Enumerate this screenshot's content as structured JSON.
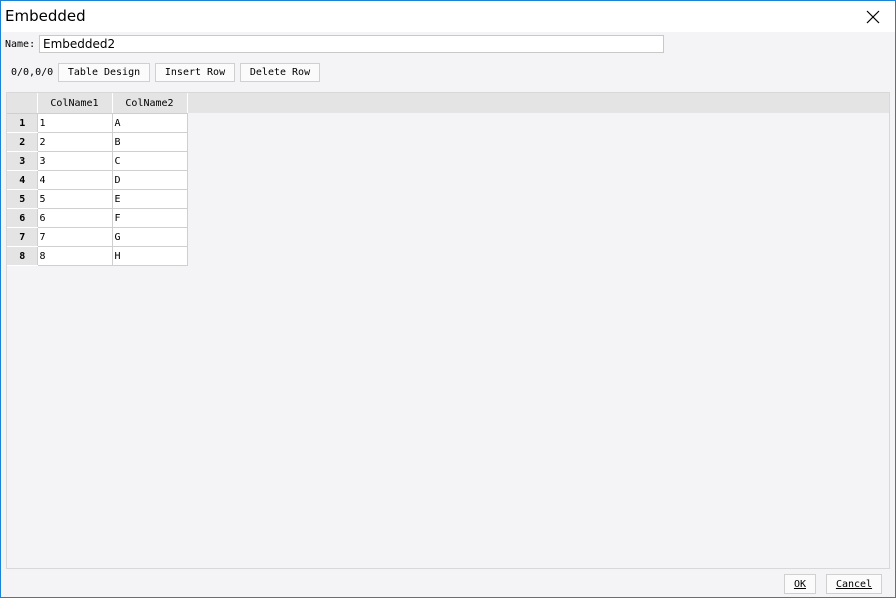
{
  "window": {
    "title": "Embedded",
    "close_icon": "close-icon"
  },
  "name_field": {
    "label": "Name:",
    "value": "Embedded2"
  },
  "toolbar": {
    "position": "0/0,0/0",
    "table_design_label": "Table Design",
    "insert_row_label": "Insert Row",
    "delete_row_label": "Delete Row"
  },
  "grid": {
    "columns": [
      "ColName1",
      "ColName2"
    ],
    "rows": [
      {
        "num": "1",
        "cells": [
          "1",
          "A"
        ]
      },
      {
        "num": "2",
        "cells": [
          "2",
          "B"
        ]
      },
      {
        "num": "3",
        "cells": [
          "3",
          "C"
        ]
      },
      {
        "num": "4",
        "cells": [
          "4",
          "D"
        ]
      },
      {
        "num": "5",
        "cells": [
          "5",
          "E"
        ]
      },
      {
        "num": "6",
        "cells": [
          "6",
          "F"
        ]
      },
      {
        "num": "7",
        "cells": [
          "7",
          "G"
        ]
      },
      {
        "num": "8",
        "cells": [
          "8",
          "H"
        ]
      }
    ]
  },
  "footer": {
    "ok_label": "OK",
    "cancel_label": "Cancel"
  },
  "colors": {
    "window_border": "#1883d7",
    "header_bg": "#e4e4e4",
    "body_bg": "#f4f4f6"
  }
}
